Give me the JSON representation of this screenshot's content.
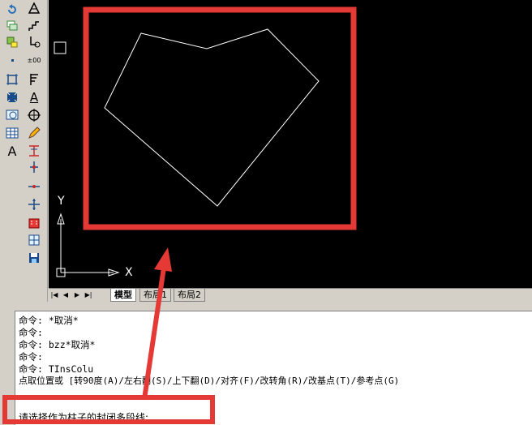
{
  "canvas": {
    "ucs_x_label": "X",
    "ucs_y_label": "Y"
  },
  "layout_tabs": {
    "nav": [
      "|◀",
      "◀",
      "▶",
      "▶|"
    ],
    "tabs": [
      "模型",
      "布局1",
      "布局2"
    ],
    "active_tab": "模型"
  },
  "command_history": [
    "命令: *取消*",
    "命令:",
    "命令: bzz*取消*",
    "命令:",
    "命令: TInsColu",
    "点取位置或 [转90度(A)/左右翻(S)/上下翻(D)/对齐(F)/改转角(R)/改基点(T)/参考点(G)"
  ],
  "command_prompt": "请选择作为柱子的封闭多段线:",
  "toolbar": {
    "text_tool_label": "A",
    "text_tool_label_2": "A",
    "elevation_label": "±00"
  },
  "colors": {
    "highlight": "#e53935",
    "canvas_bg": "#000000",
    "polyline": "#ffffff"
  },
  "icons": [
    "undo-icon",
    "dimension-icon",
    "layers-icon",
    "stairs-icon",
    "point-icon",
    "elevation-icon",
    "frame-icon",
    "flag-icon",
    "block-icon",
    "text-icon",
    "view-icon",
    "circle-target-icon",
    "table-icon",
    "pen-icon",
    "text-A-icon",
    "column-icon",
    "axis-icon",
    "building-icon",
    "grid-icon",
    "save-icon"
  ]
}
